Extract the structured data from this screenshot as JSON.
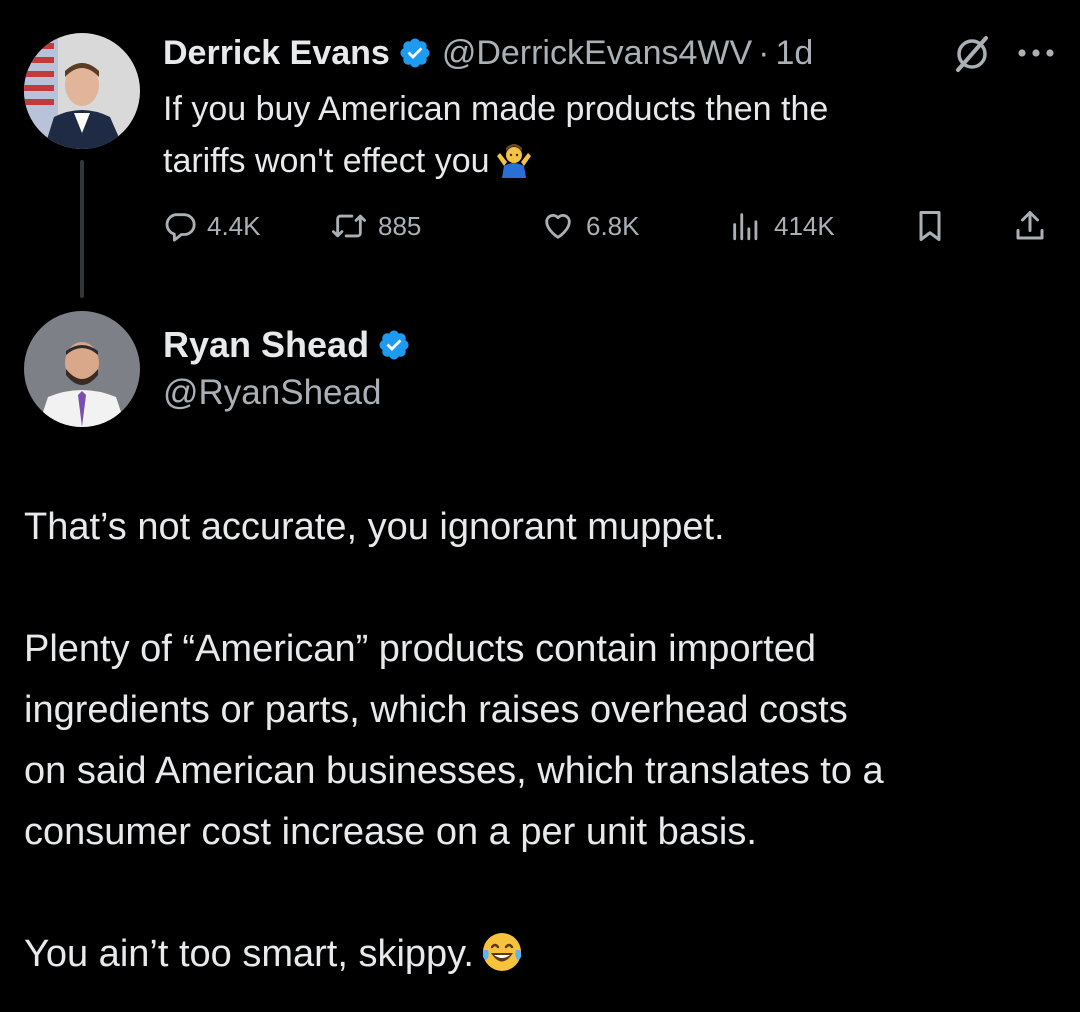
{
  "tweet1": {
    "author_name": "Derrick Evans",
    "handle": "@DerrickEvans4WV",
    "separator": "·",
    "time": "1d",
    "text_line1": "If you buy American made products then the",
    "text_line2": "tariffs won't effect you",
    "emoji": "shrug-emoji",
    "stats": {
      "replies": "4.4K",
      "reposts": "885",
      "likes": "6.8K",
      "views": "414K"
    },
    "icons": [
      "reply-icon",
      "repost-icon",
      "like-icon",
      "views-icon",
      "bookmark-icon",
      "share-icon",
      "grok-icon",
      "more-icon",
      "verified-badge-icon"
    ]
  },
  "tweet2": {
    "author_name": "Ryan Shead",
    "handle": "@RyanShead",
    "paragraph1": "That’s not accurate, you ignorant muppet.",
    "paragraph2_line1": "Plenty of “American” products contain imported",
    "paragraph2_line2": "ingredients or parts, which raises overhead costs",
    "paragraph2_line3": "on said American businesses, which translates to a",
    "paragraph2_line4": "consumer cost increase on a per unit basis.",
    "paragraph3": "You ain’t too smart, skippy.",
    "emoji": "laughing-tears-emoji"
  },
  "colors": {
    "background": "#000000",
    "text": "#e7e9ea",
    "secondary_text": "#a9b0b6",
    "verified_blue": "#1d9bf0",
    "thread_line": "#333639"
  }
}
